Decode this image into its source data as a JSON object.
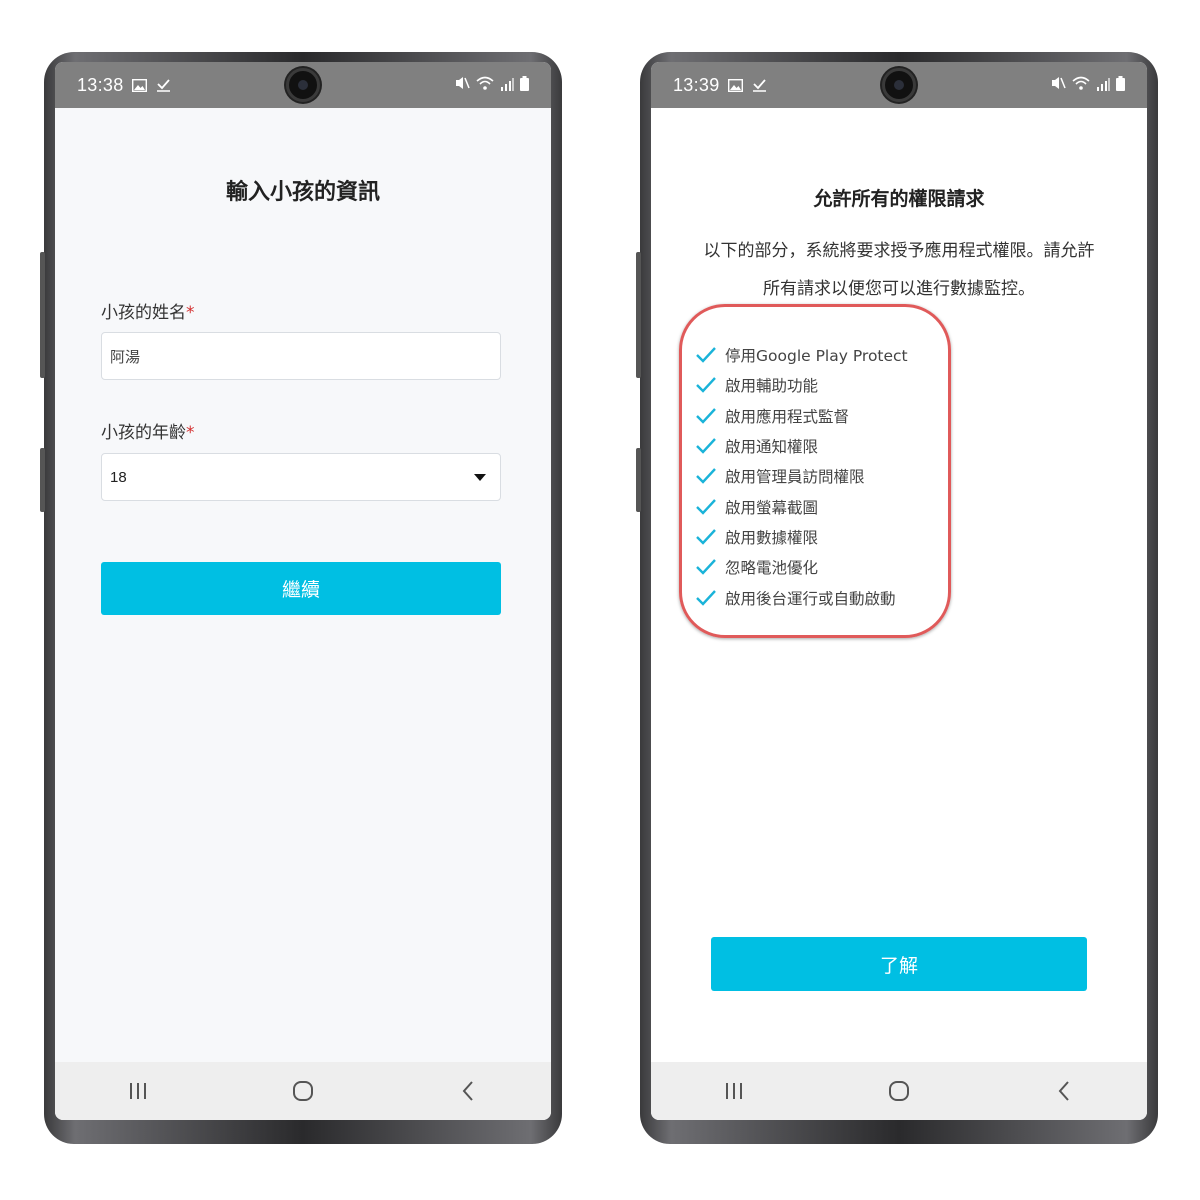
{
  "left_phone": {
    "status_bar": {
      "time": "13:38"
    },
    "form": {
      "title": "輸入小孩的資訊",
      "name_label": "小孩的姓名",
      "required_mark": "*",
      "name_value": "阿湯",
      "age_label": "小孩的年齡",
      "age_value": "18",
      "continue_button": "繼續"
    }
  },
  "right_phone": {
    "status_bar": {
      "time": "13:39"
    },
    "permissions": {
      "title": "允許所有的權限請求",
      "description_line1": "以下的部分，系統將要求授予應用程式權限。請允許",
      "description_line2": "所有請求以便您可以進行數據監控。",
      "items": [
        "停用Google Play Protect",
        "啟用輔助功能",
        "啟用應用程式監督",
        "啟用通知權限",
        "啟用管理員訪問權限",
        "啟用螢幕截圖",
        "啟用數據權限",
        "忽略電池優化",
        "啟用後台運行或自動啟動"
      ],
      "ok_button": "了解"
    }
  },
  "nav_icons": [
    "recent-apps-icon",
    "home-icon",
    "back-icon"
  ],
  "colors": {
    "accent": "#00bfe3",
    "check": "#1ab3d9",
    "highlight": "#e05a5a",
    "required": "#d32f2f",
    "status_bar": "#808080"
  }
}
